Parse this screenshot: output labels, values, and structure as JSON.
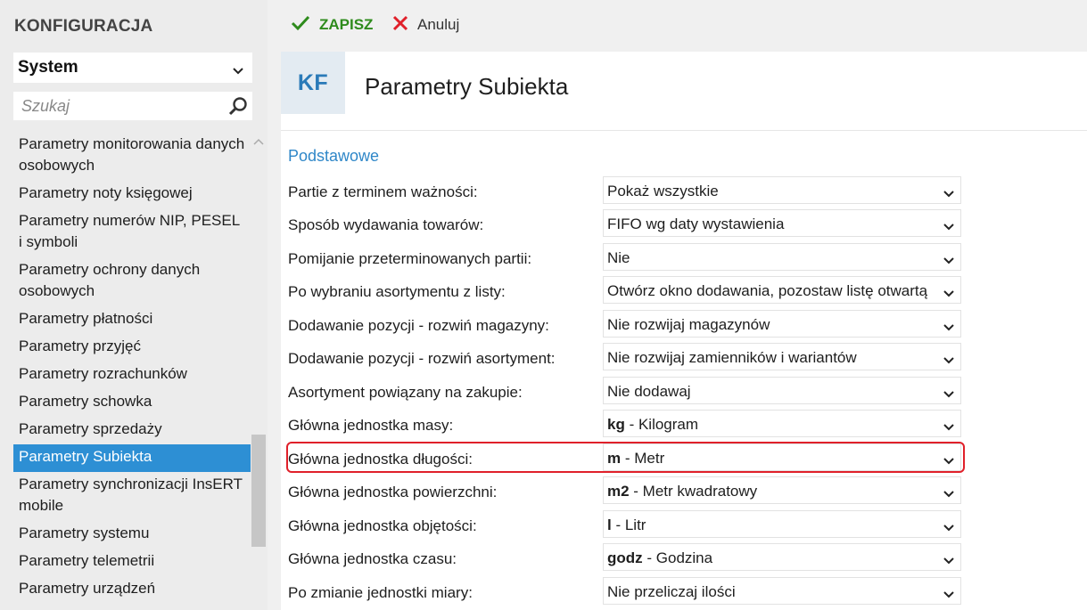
{
  "sidebar": {
    "title": "KONFIGURACJA",
    "module": "System",
    "search_placeholder": "Szukaj",
    "items": [
      {
        "label": "Parametry monitorowania danych osobowych"
      },
      {
        "label": "Parametry noty księgowej"
      },
      {
        "label": "Parametry numerów NIP, PESEL i symboli"
      },
      {
        "label": "Parametry ochrony danych osobowych"
      },
      {
        "label": "Parametry płatności"
      },
      {
        "label": "Parametry przyjęć"
      },
      {
        "label": "Parametry rozrachunków"
      },
      {
        "label": "Parametry schowka"
      },
      {
        "label": "Parametry sprzedaży"
      },
      {
        "label": "Parametry Subiekta",
        "selected": true
      },
      {
        "label": "Parametry synchronizacji InsERT mobile"
      },
      {
        "label": "Parametry systemu"
      },
      {
        "label": "Parametry telemetrii"
      },
      {
        "label": "Parametry urządzeń"
      }
    ]
  },
  "toolbar": {
    "save_label": "ZAPISZ",
    "cancel_label": "Anuluj"
  },
  "header": {
    "badge": "KF",
    "title": "Parametry Subiekta"
  },
  "section": {
    "title": "Podstawowe"
  },
  "params": [
    {
      "label": "Partie z terminem ważności:",
      "code": "",
      "value": "Pokaż wszystkie"
    },
    {
      "label": "Sposób wydawania towarów:",
      "code": "",
      "value": "FIFO wg daty wystawienia"
    },
    {
      "label": "Pomijanie przeterminowanych partii:",
      "code": "",
      "value": "Nie"
    },
    {
      "label": "Po wybraniu asortymentu z listy:",
      "code": "",
      "value": "Otwórz okno dodawania, pozostaw listę otwartą"
    },
    {
      "label": "Dodawanie pozycji - rozwiń magazyny:",
      "code": "",
      "value": "Nie rozwijaj magazynów"
    },
    {
      "label": "Dodawanie pozycji - rozwiń asortyment:",
      "code": "",
      "value": "Nie rozwijaj zamienników i wariantów"
    },
    {
      "label": "Asortyment powiązany na zakupie:",
      "code": "",
      "value": "Nie dodawaj"
    },
    {
      "label": "Główna jednostka masy:",
      "code": "kg",
      "value": " - Kilogram"
    },
    {
      "label": "Główna jednostka długości:",
      "code": "m",
      "value": " - Metr",
      "highlighted": true
    },
    {
      "label": "Główna jednostka powierzchni:",
      "code": "m2",
      "value": " - Metr kwadratowy"
    },
    {
      "label": "Główna jednostka objętości:",
      "code": "l",
      "value": " - Litr"
    },
    {
      "label": "Główna jednostka czasu:",
      "code": "godz",
      "value": " - Godzina"
    },
    {
      "label": "Po zmianie jednostki miary:",
      "code": "",
      "value": "Nie przeliczaj ilości"
    }
  ],
  "colors": {
    "accent": "#2d8fd4",
    "save": "#2e8b1c",
    "cancel": "#e0202a",
    "highlight": "#e0202a",
    "section": "#2f87c8"
  },
  "icons": {
    "save": "check-icon",
    "cancel": "close-icon",
    "search": "search-icon",
    "dropdown": "chevron-down-icon",
    "scroll": "chevron-up-icon"
  }
}
